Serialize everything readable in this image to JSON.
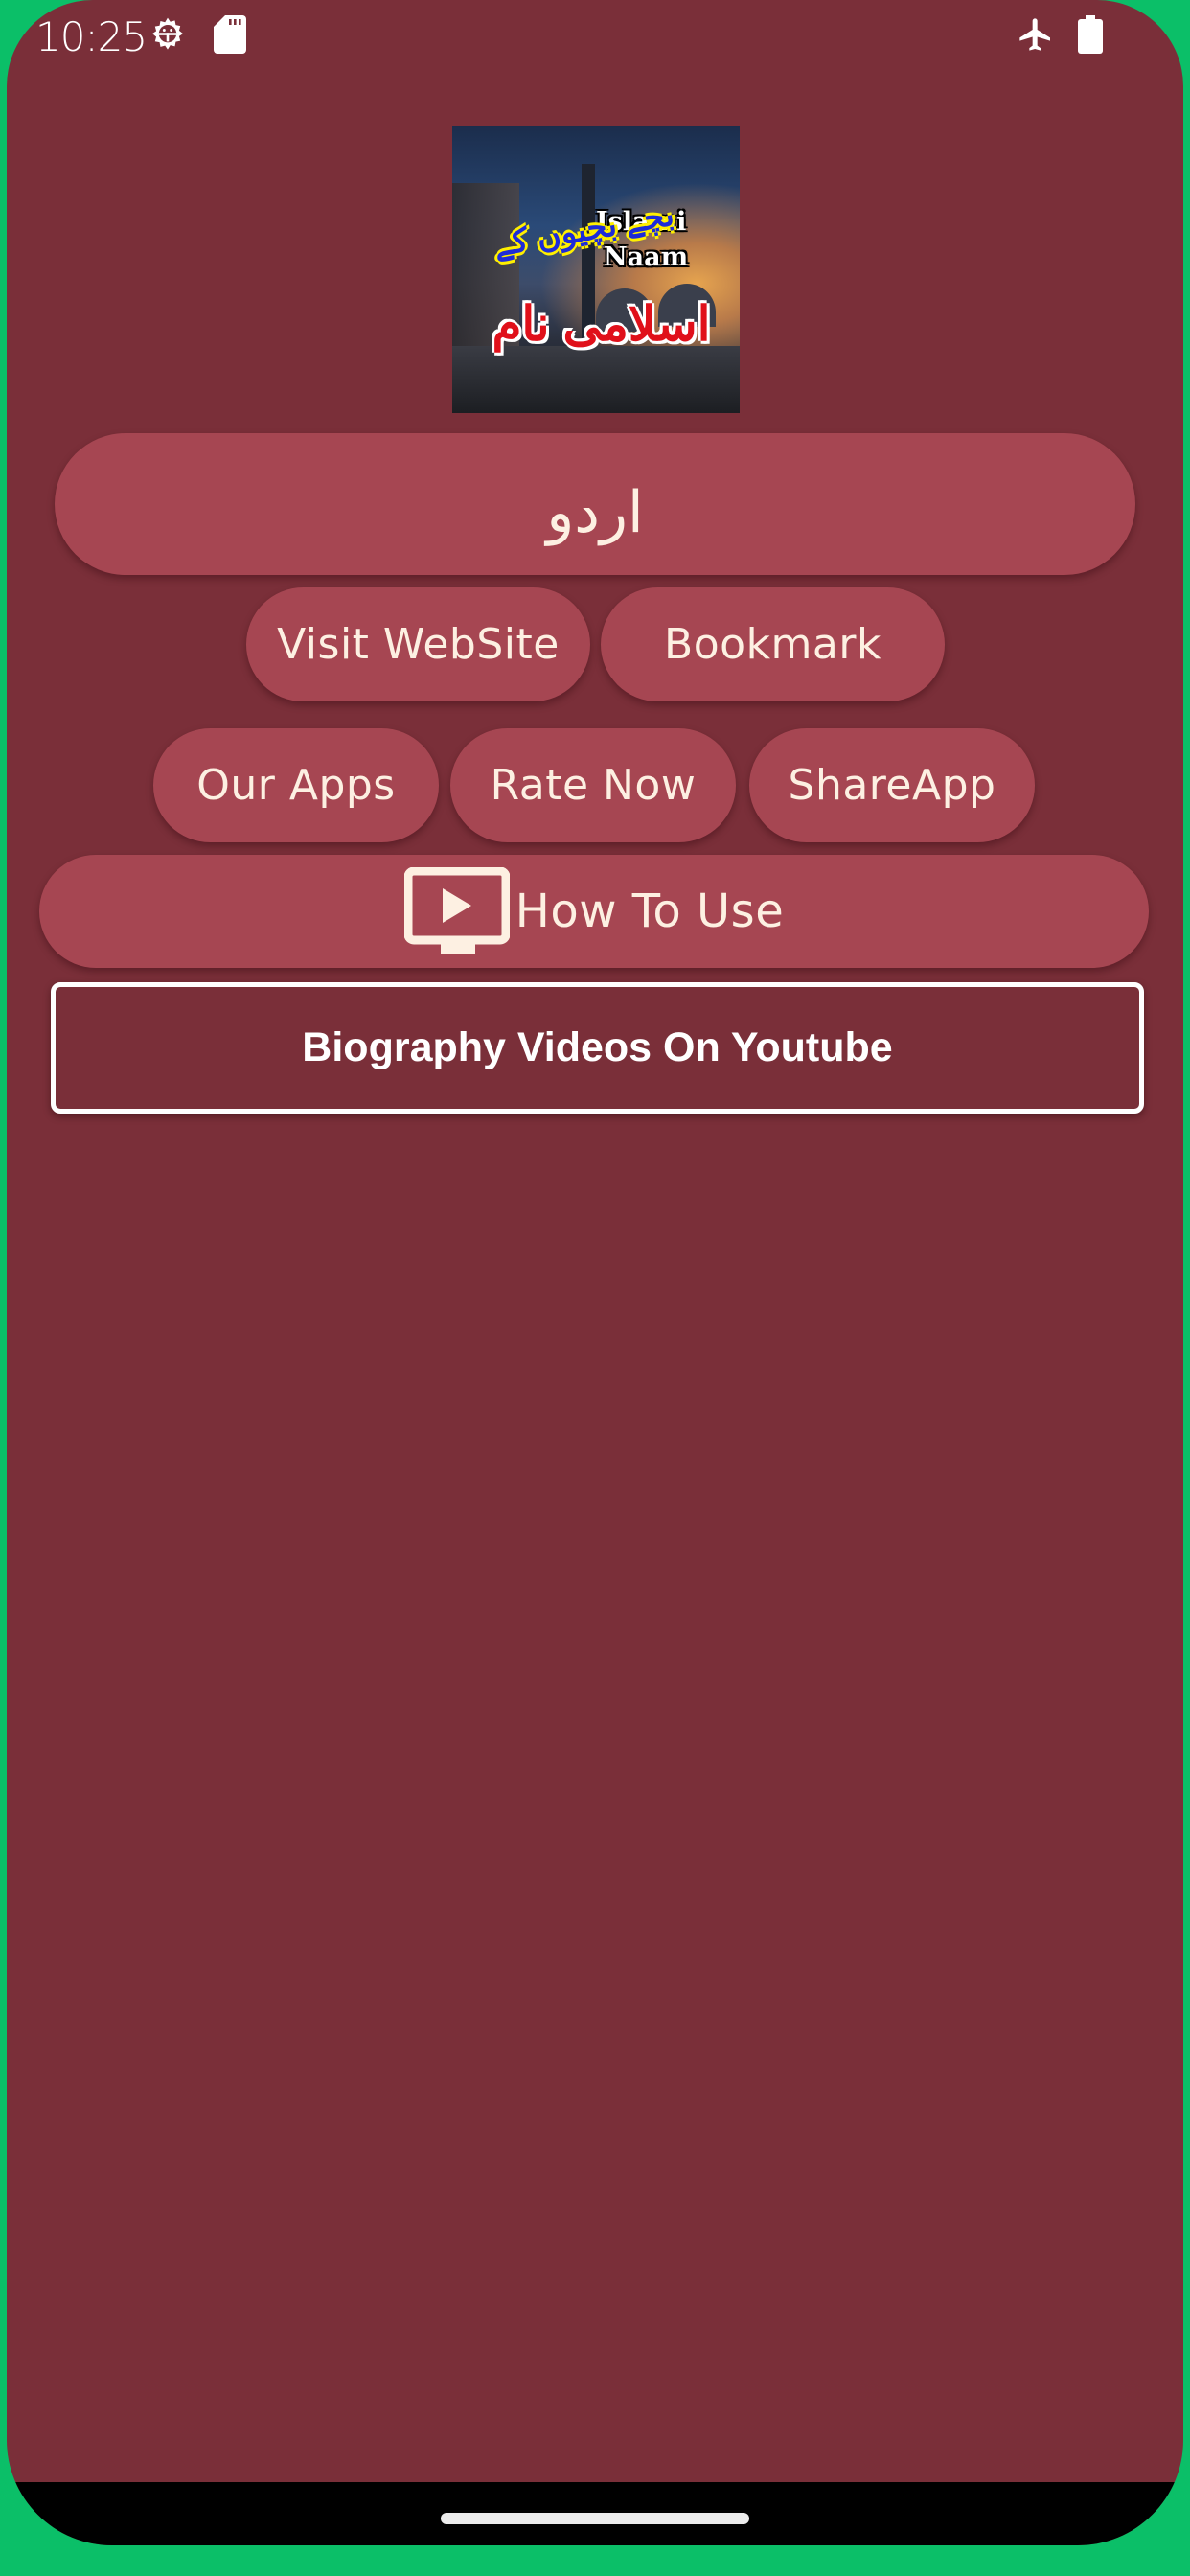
{
  "status_bar": {
    "time": "10:25",
    "left_icons": [
      "gear-icon",
      "sd-card-icon"
    ],
    "right_icons": [
      "airplane-mode-icon",
      "battery-icon"
    ]
  },
  "logo": {
    "title_en_line1": "Islami",
    "title_en_line2": "Naam",
    "title_ur_small": "بچے بچیوں کے",
    "title_ur_large": "اسلامی نام"
  },
  "buttons": {
    "urdu": "اردو",
    "visit_website": "Visit WebSite",
    "bookmark": "Bookmark",
    "our_apps": "Our Apps",
    "rate_now": "Rate Now",
    "share_app": "ShareApp",
    "how_to_use": "How To Use",
    "biography_videos": "Biography Videos On Youtube"
  },
  "colors": {
    "background": "#7a2f39",
    "button": "#a64652",
    "button_text": "#fdf0e2",
    "frame": "#0bbf68"
  }
}
